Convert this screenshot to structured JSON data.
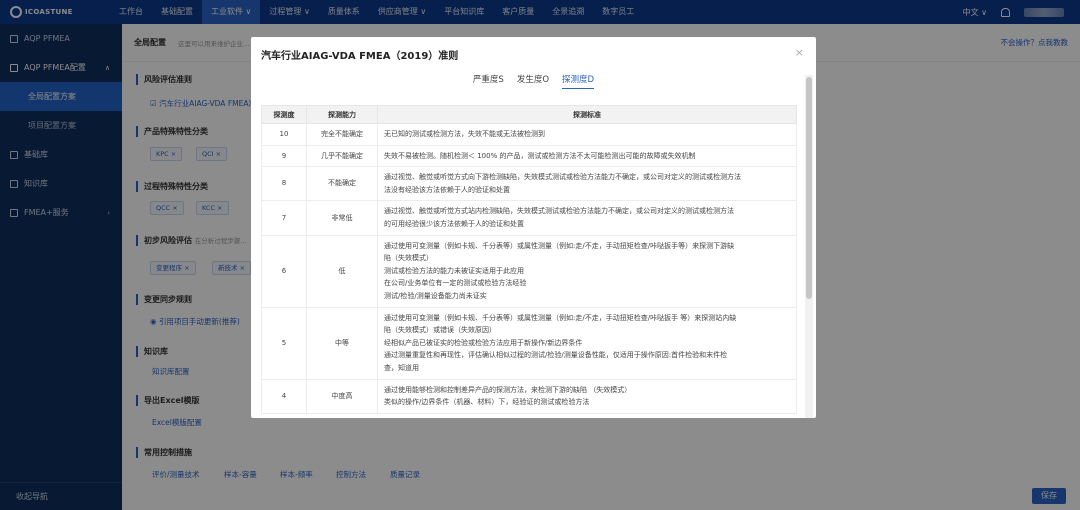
{
  "app": {
    "logo_text": "ICOASTUNE"
  },
  "top_nav": {
    "items": [
      "工作台",
      "基础配置",
      "工业软件",
      "过程管理",
      "质量体系",
      "供应商管理",
      "平台知识库",
      "客户质量",
      "全景追溯",
      "数字员工"
    ],
    "language": "中文",
    "dropdown_marks": [
      "∨",
      "∨",
      "∨",
      "∨"
    ]
  },
  "sidebar": {
    "items": [
      "AQP PFMEA",
      "AQP PFMEA配置",
      "全局配置方案",
      "项目配置方案",
      "基础库",
      "知识库",
      "FMEA+服务"
    ],
    "expand_arrow": "∧",
    "more_arrow": "›",
    "collapse_label": "收起导航"
  },
  "main": {
    "title": "全局配置",
    "hint": "这里可以用来维护企业…",
    "help_link": "不会操作？点我教教",
    "sections": {
      "risk": "风险评估准则",
      "risk_checkbox": "汽车行业AIAG-VDA FMEA准则",
      "product_class": "产品特殊特性分类",
      "product_chips": [
        "KPC ×",
        "QCI ×"
      ],
      "process_class": "过程特殊特性分类",
      "process_chips": [
        "QCC ×",
        "KCC ×"
      ],
      "initial_risk": "初步风险评估",
      "initial_hint": "在分析过程步骤…",
      "initial_chips": [
        "变更程序 ×",
        "新技术 ×"
      ],
      "change": "变更同步规则",
      "change_option": "引用项目手动更新(推荐)",
      "kb": "知识库",
      "kb_link": "知识库配置",
      "excel": "导出Excel模版",
      "excel_link": "Excel模版配置",
      "measures": "常用控制措施",
      "measure_links": [
        "评价/测量技术",
        "样本-容量",
        "样本-频率",
        "控制方法",
        "质量记录"
      ]
    },
    "save_label": "保存"
  },
  "modal": {
    "title": "汽车行业AIAG-VDA FMEA（2019）准则",
    "close": "×",
    "tabs": [
      "严重度S",
      "发生度O",
      "探测度D"
    ],
    "active_tab": 2,
    "columns": [
      "探测度",
      "探测能力",
      "探测标准"
    ],
    "rows": [
      {
        "score": "10",
        "ability": "完全不能确定",
        "criteria": [
          "无已知的测试或检测方法，失效不能或无法被检测到"
        ]
      },
      {
        "score": "9",
        "ability": "几乎不能确定",
        "criteria": [
          "失效不易被检测。随机检测＜ 100% 的产品，测试或检测方法不太可能检测出可能的故障或失效机制"
        ]
      },
      {
        "score": "8",
        "ability": "不能确定",
        "criteria": [
          "通过视觉、触觉或听觉方式向下游检测缺陷，失效模式测试或检验方法能力不确定，或公司对定义的测试或检测方法",
          "法没有经验该方法依赖于人的验证和处置"
        ]
      },
      {
        "score": "7",
        "ability": "非常低",
        "criteria": [
          "通过视觉、触觉或听觉方式站内检测缺陷，失效模式测试或检验方法能力不确定，或公司对定义的测试或检测方法",
          "的可用经验很少该方法依赖于人的验证和处置"
        ]
      },
      {
        "score": "6",
        "ability": "低",
        "criteria": [
          "通过使用可变测量（例如卡规、千分表等）或属性测量（例如:走/不走，手动扭矩检查/咔哒扳手等）来探测下游缺",
          "陷（失效模式）",
          "测试或检验方法的能力未被证实适用于此应用",
          "在公司/业务单位有一定的测试或检验方法经验",
          "测试/检验/测量设备能力尚未证实"
        ]
      },
      {
        "score": "5",
        "ability": "中等",
        "criteria": [
          "通过使用可变测量（例如卡规、千分表等）或属性测量（例如:走/不走，手动扭矩检查/咔哒扳手 等）来探测站内缺",
          "陷（失效模式）或错误（失效原因）",
          "经相似产品已被证实的检验或检验方法应用于新操作/新边界条件",
          "通过测量重复性和再现性，评估确认相似过程的测试/检验/测量设备性能，仅适用于操作原因:首件检验和末件检",
          "查，知道用"
        ]
      },
      {
        "score": "4",
        "ability": "中度高",
        "criteria": [
          "通过使用能够检测和控制差异产品的探测方法，来检测下游的缺陷 （失效模式）",
          "类似的操作/边界条件（机器、材料）下，经验证的测试或检验方法"
        ]
      }
    ]
  }
}
